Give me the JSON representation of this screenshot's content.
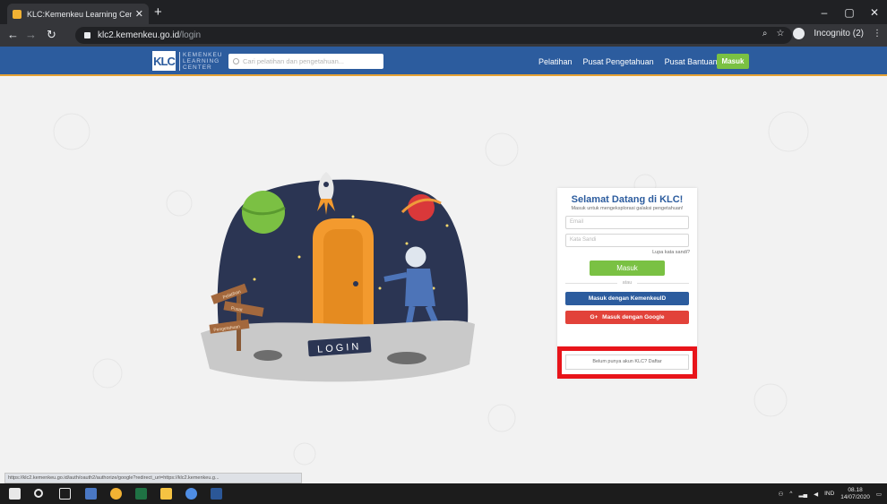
{
  "browser": {
    "tab_title": "KLC:Kemenkeu Learning Center",
    "tab_close": "✕",
    "new_tab": "+",
    "url_host": "klc2.kemenkeu.go.id",
    "url_path": "/login",
    "incognito_label": "Incognito (2)",
    "window_buttons": [
      "–",
      "▢",
      "✕"
    ]
  },
  "site": {
    "logo_mark": "KLC",
    "logo_text": [
      "KEMENKEU",
      "LEARNING",
      "CENTER"
    ],
    "search_placeholder": "Cari pelatihan dan pengetahuan...",
    "nav": [
      "Pelatihan",
      "Pusat Pengetahuan",
      "Pusat Bantuan"
    ],
    "masuk_top": "Masuk"
  },
  "login": {
    "title": "Selamat Datang di KLC!",
    "subtitle": "Masuk untuk mengeksplorasi galaksi pengetahuan!",
    "email_placeholder": "Email",
    "password_placeholder": "Kata Sandi",
    "forgot": "Lupa kata sandi?",
    "submit": "Masuk",
    "or": "atau",
    "sso_button": "Masuk dengan KemenkeuID",
    "google_button": "Masuk dengan Google",
    "google_icon": "G+",
    "register_prompt": "Belum punya akun KLC?  Daftar"
  },
  "illustration": {
    "door_sign": "LOGIN",
    "signposts": [
      "Pelatihan",
      "Pusat",
      "Pengetahuan"
    ]
  },
  "status_link": "https://klc2.kemenkeu.go.id/auth/oauth2/authorize/google?redirect_uri=https://klc2.kemenkeu.g...",
  "taskbar": {
    "lang": "IND",
    "time": "08.18",
    "date": "14/07/2020"
  },
  "colors": {
    "brand_blue": "#2c5c9e",
    "green": "#7ac143",
    "google_red": "#e2423a",
    "highlight": "#e8141a"
  }
}
